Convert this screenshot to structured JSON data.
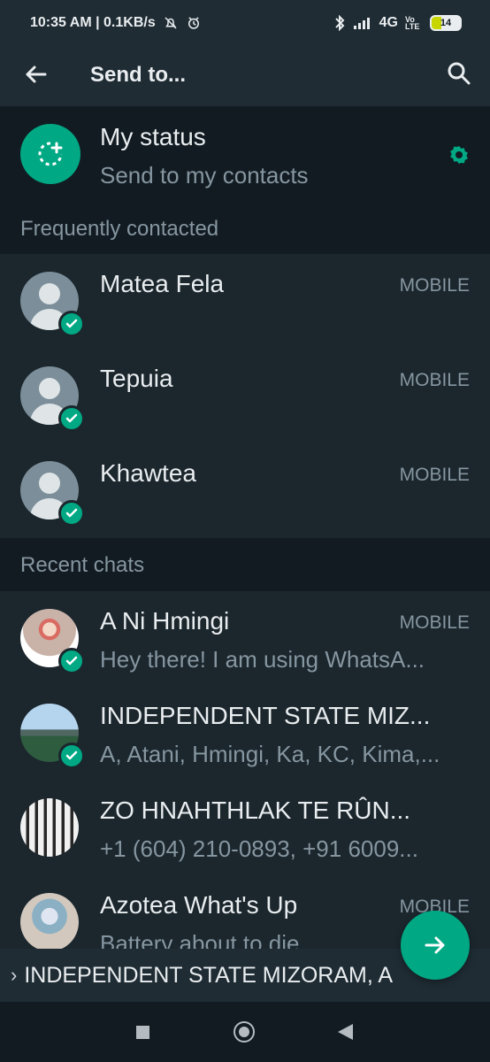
{
  "status_bar": {
    "time_speed": "10:35 AM | 0.1KB/s",
    "network": "4G",
    "volte": "Vo LTE",
    "battery": "14"
  },
  "app_bar": {
    "title": "Send to..."
  },
  "my_status": {
    "title": "My status",
    "subtitle": "Send to my contacts"
  },
  "sections": {
    "frequent": "Frequently contacted",
    "recent": "Recent chats"
  },
  "frequent_contacts": [
    {
      "name": "Matea Fela",
      "type": "MOBILE"
    },
    {
      "name": "Tepuia",
      "type": "MOBILE"
    },
    {
      "name": "Khawtea",
      "type": "MOBILE"
    }
  ],
  "recent_chats": [
    {
      "name": "A Ni Hmingi",
      "type": "MOBILE",
      "subtitle": "Hey there! I am using WhatsA..."
    },
    {
      "name": "INDEPENDENT STATE MIZ...",
      "type": "",
      "subtitle": "A, Atani, Hmingi, Ka, KC, Kima,..."
    },
    {
      "name": "ZO HNAHTHLAK TE RÛN...",
      "type": "",
      "subtitle": "+1 (604) 210-0893, +91 6009..."
    },
    {
      "name": "Azotea What's Up",
      "type": "MOBILE",
      "subtitle": "Battery about to die"
    }
  ],
  "selected_bar": {
    "text": "INDEPENDENT STATE MIZORAM, A"
  },
  "colors": {
    "accent": "#00a884",
    "background": "#121b22",
    "surface": "#1b262d",
    "toolbar": "#1f2c34"
  },
  "icons": [
    "back-arrow-icon",
    "search-icon",
    "status-add-icon",
    "settings-icon",
    "check-icon",
    "send-icon"
  ]
}
